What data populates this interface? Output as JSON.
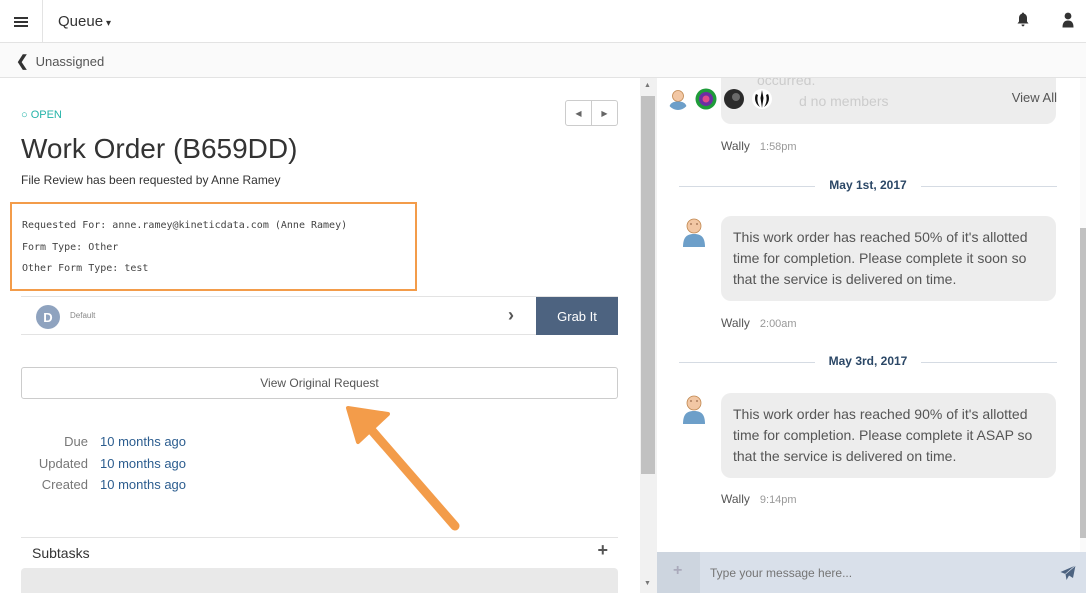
{
  "topbar": {
    "queue_label": "Queue",
    "caret": "▾"
  },
  "breadcrumb": {
    "label": "Unassigned"
  },
  "task": {
    "status": "OPEN",
    "title": "Work Order (B659DD)",
    "subtitle": "File Review has been requested by Anne Ramey",
    "fields": [
      "Requested For: anne.ramey@kineticdata.com (Anne Ramey)",
      "Form Type: Other",
      "Other Form Type: test"
    ],
    "assignee_initial": "D",
    "assignee_label": "Default",
    "grab_label": "Grab It",
    "view_request_label": "View Original Request",
    "dates": [
      {
        "label": "Due",
        "value": "10 months ago"
      },
      {
        "label": "Updated",
        "value": "10 months ago"
      },
      {
        "label": "Created",
        "value": "10 months ago"
      }
    ],
    "subtasks_label": "Subtasks",
    "subtasks_add": "+"
  },
  "discussion": {
    "view_all_label": "View All",
    "ghost_line1": "occurred.",
    "ghost_line2": "d no members",
    "first_sender": {
      "name": "Wally",
      "time": "1:58pm"
    },
    "groups": [
      {
        "date": "May 1st, 2017",
        "message": "This work order has reached 50% of it's allotted time for completion. Please complete it soon so that the service is delivered on time.",
        "sender": "Wally",
        "time": "2:00am"
      },
      {
        "date": "May 3rd, 2017",
        "message": "This work order has reached 90% of it's allotted time for completion. Please complete it ASAP so that the service is delivered on time.",
        "sender": "Wally",
        "time": "9:14pm"
      }
    ],
    "composer_placeholder": "Type your message here...",
    "composer_plus": "+"
  },
  "icons": {
    "menu": "hamburger-icon",
    "bell": "bell-icon",
    "user": "user-icon",
    "back": "chevron-left-icon",
    "send": "paper-plane-icon"
  },
  "colors": {
    "status": "#24b3a8",
    "grab_button": "#4d6380",
    "highlight": "#f39c4a",
    "link": "#2c5d8f"
  }
}
